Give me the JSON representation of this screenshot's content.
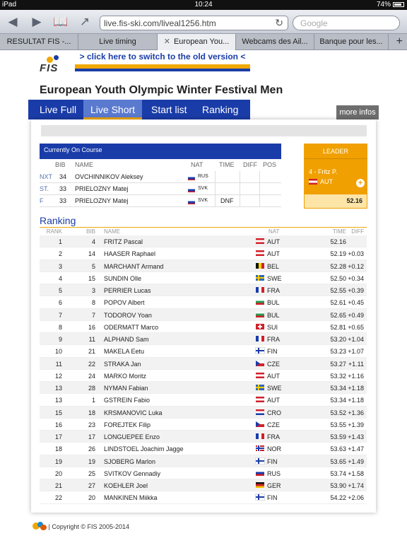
{
  "status_bar": {
    "device": "iPad",
    "time": "10:24",
    "battery": "74%"
  },
  "browser": {
    "url": "live.fis-ski.com/liveal1256.htm",
    "search_placeholder": "Google",
    "tabs": [
      {
        "label": "RESULTAT FIS -..."
      },
      {
        "label": "Live timing"
      },
      {
        "label": "European You..."
      },
      {
        "label": "Webcams des Ail..."
      },
      {
        "label": "Banque pour les..."
      }
    ]
  },
  "page": {
    "logo_text": "FIS",
    "old_version_link": "> click here to switch to the old version <",
    "title": "European Youth Olympic Winter Festival Men",
    "nav": [
      "Live Full",
      "Live Short",
      "Start list",
      "Ranking"
    ],
    "more_info": "more infos",
    "on_course": {
      "header": "Currently On Course",
      "columns": {
        "bib": "BIB",
        "name": "NAME",
        "nat": "NAT",
        "time": "TIME",
        "diff": "DIFF",
        "pos": "POS"
      },
      "rows": [
        {
          "label": "NXT",
          "bib": "34",
          "name": "OVCHINNIKOV Aleksey",
          "nat": "RUS",
          "time": "",
          "diff": "",
          "pos": ""
        },
        {
          "label": "ST.",
          "bib": "33",
          "name": "PRIELOZNY Matej",
          "nat": "SVK",
          "time": "",
          "diff": "",
          "pos": ""
        },
        {
          "label": "F",
          "bib": "33",
          "name": "PRIELOZNY Matej",
          "nat": "SVK",
          "time": "DNF",
          "diff": "",
          "pos": ""
        }
      ]
    },
    "leader": {
      "title": "LEADER",
      "name": "4 - Fritz P.",
      "nat": "AUT",
      "time": "52.16"
    },
    "ranking": {
      "title": "Ranking",
      "columns": {
        "rank": "RANK",
        "bib": "BIB",
        "name": "NAME",
        "nat": "NAT",
        "time": "TIME",
        "diff": "DIFF"
      },
      "rows": [
        {
          "rank": "1",
          "bib": "4",
          "name": "FRITZ Pascal",
          "nat": "AUT",
          "time": "52.16",
          "diff": ""
        },
        {
          "rank": "2",
          "bib": "14",
          "name": "HAASER Raphael",
          "nat": "AUT",
          "time": "52.19",
          "diff": "+0.03"
        },
        {
          "rank": "3",
          "bib": "5",
          "name": "MARCHANT Armand",
          "nat": "BEL",
          "time": "52.28",
          "diff": "+0.12"
        },
        {
          "rank": "4",
          "bib": "15",
          "name": "SUNDIN Olle",
          "nat": "SWE",
          "time": "52.50",
          "diff": "+0.34"
        },
        {
          "rank": "5",
          "bib": "3",
          "name": "PERRIER Lucas",
          "nat": "FRA",
          "time": "52.55",
          "diff": "+0.39"
        },
        {
          "rank": "6",
          "bib": "8",
          "name": "POPOV Albert",
          "nat": "BUL",
          "time": "52.61",
          "diff": "+0.45"
        },
        {
          "rank": "7",
          "bib": "7",
          "name": "TODOROV Yoan",
          "nat": "BUL",
          "time": "52.65",
          "diff": "+0.49"
        },
        {
          "rank": "8",
          "bib": "16",
          "name": "ODERMATT Marco",
          "nat": "SUI",
          "time": "52.81",
          "diff": "+0.65"
        },
        {
          "rank": "9",
          "bib": "11",
          "name": "ALPHAND Sam",
          "nat": "FRA",
          "time": "53.20",
          "diff": "+1.04"
        },
        {
          "rank": "10",
          "bib": "21",
          "name": "MAKELA Eetu",
          "nat": "FIN",
          "time": "53.23",
          "diff": "+1.07"
        },
        {
          "rank": "11",
          "bib": "22",
          "name": "STRAKA Jan",
          "nat": "CZE",
          "time": "53.27",
          "diff": "+1.11"
        },
        {
          "rank": "12",
          "bib": "24",
          "name": "MARKO Moritz",
          "nat": "AUT",
          "time": "53.32",
          "diff": "+1.16"
        },
        {
          "rank": "13",
          "bib": "28",
          "name": "NYMAN Fabian",
          "nat": "SWE",
          "time": "53.34",
          "diff": "+1.18"
        },
        {
          "rank": "13",
          "bib": "1",
          "name": "GSTREIN Fabio",
          "nat": "AUT",
          "time": "53.34",
          "diff": "+1.18"
        },
        {
          "rank": "15",
          "bib": "18",
          "name": "KRSMANOVIC Luka",
          "nat": "CRO",
          "time": "53.52",
          "diff": "+1.36"
        },
        {
          "rank": "16",
          "bib": "23",
          "name": "FOREJTEK Filip",
          "nat": "CZE",
          "time": "53.55",
          "diff": "+1.39"
        },
        {
          "rank": "17",
          "bib": "17",
          "name": "LONGUEPEE Enzo",
          "nat": "FRA",
          "time": "53.59",
          "diff": "+1.43"
        },
        {
          "rank": "18",
          "bib": "26",
          "name": "LINDSTOEL Joachim Jagge",
          "nat": "NOR",
          "time": "53.63",
          "diff": "+1.47"
        },
        {
          "rank": "19",
          "bib": "19",
          "name": "SJOBERG Marlon",
          "nat": "FIN",
          "time": "53.65",
          "diff": "+1.49"
        },
        {
          "rank": "20",
          "bib": "25",
          "name": "SVITKOV Gennadiy",
          "nat": "RUS",
          "time": "53.74",
          "diff": "+1.58"
        },
        {
          "rank": "21",
          "bib": "27",
          "name": "KOEHLER Joel",
          "nat": "GER",
          "time": "53.90",
          "diff": "+1.74"
        },
        {
          "rank": "22",
          "bib": "20",
          "name": "MANKINEN Miikka",
          "nat": "FIN",
          "time": "54.22",
          "diff": "+2.06"
        }
      ]
    },
    "footer": "| Copyright © FIS 2005-2014"
  }
}
